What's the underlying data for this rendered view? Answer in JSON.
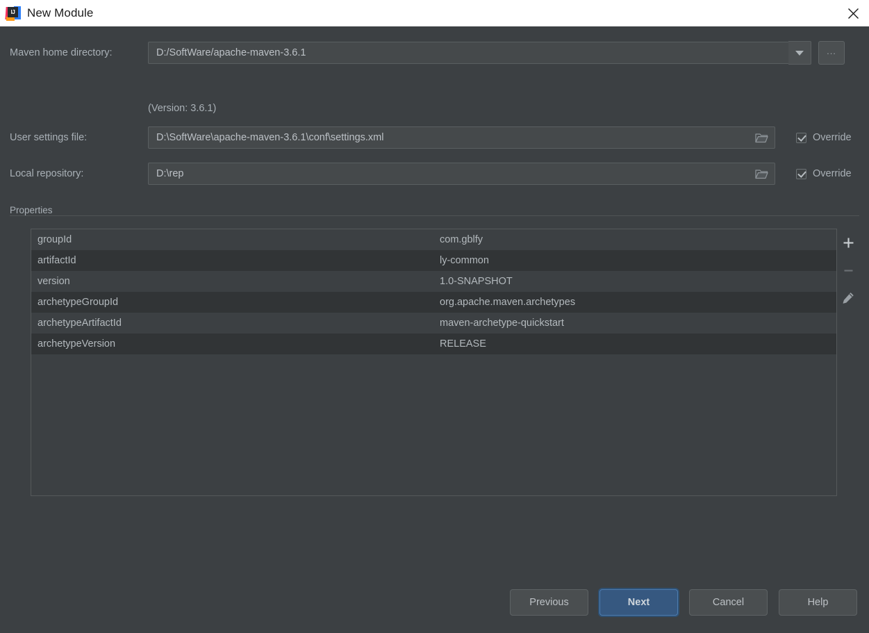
{
  "window": {
    "title": "New Module",
    "app_icon": "intellij-idea-icon",
    "icon_text": "IJ",
    "close_icon": "close-icon"
  },
  "form": {
    "maven_home": {
      "label": "Maven home directory:",
      "value": "D:/SoftWare/apache-maven-3.6.1",
      "dropdown_icon": "chevron-down-icon",
      "browse_label": "...",
      "version_note": "(Version: 3.6.1)"
    },
    "user_settings": {
      "label": "User settings file:",
      "value": "D:\\SoftWare\\apache-maven-3.6.1\\conf\\settings.xml",
      "folder_icon": "folder-icon",
      "override_label": "Override",
      "override_checked": true
    },
    "local_repository": {
      "label": "Local repository:",
      "value": "D:\\rep",
      "folder_icon": "folder-icon",
      "override_label": "Override",
      "override_checked": true
    }
  },
  "properties": {
    "group_label": "Properties",
    "rows": [
      {
        "key": "groupId",
        "value": "com.gblfy"
      },
      {
        "key": "artifactId",
        "value": "ly-common"
      },
      {
        "key": "version",
        "value": "1.0-SNAPSHOT"
      },
      {
        "key": "archetypeGroupId",
        "value": "org.apache.maven.archetypes"
      },
      {
        "key": "archetypeArtifactId",
        "value": "maven-archetype-quickstart"
      },
      {
        "key": "archetypeVersion",
        "value": "RELEASE"
      }
    ],
    "toolbar": {
      "add_icon": "plus-icon",
      "remove_icon": "minus-icon",
      "edit_icon": "pencil-icon"
    }
  },
  "footer": {
    "previous": "Previous",
    "next": "Next",
    "cancel": "Cancel",
    "help": "Help"
  },
  "colors": {
    "background": "#3c4043",
    "titlebar": "#ffffff",
    "primary_button": "#365880",
    "field_background": "#45494b",
    "row_alt": "#313436"
  }
}
